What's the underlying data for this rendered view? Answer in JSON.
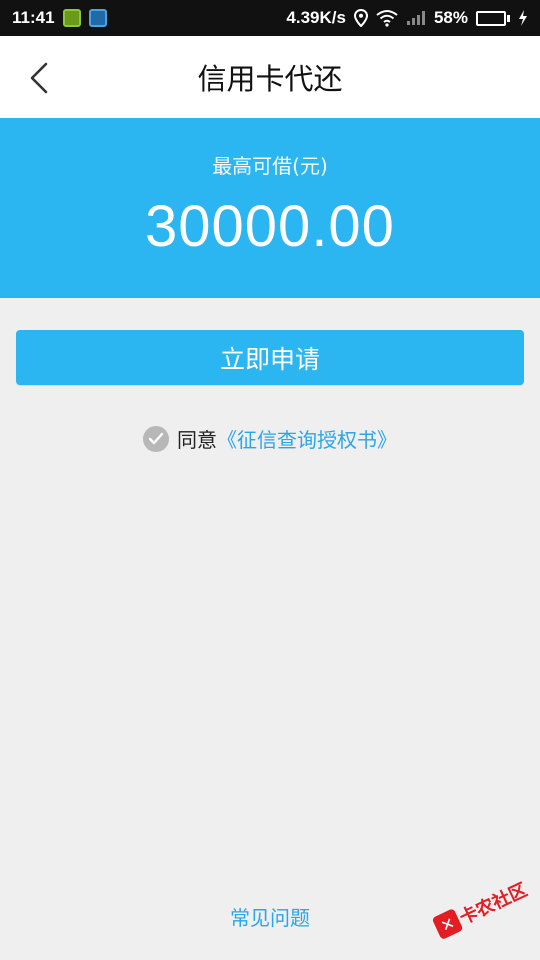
{
  "status_bar": {
    "time": "11:41",
    "net_speed": "4.39K/s",
    "battery_percent": "58%",
    "battery_level": 0.58
  },
  "nav": {
    "title": "信用卡代还"
  },
  "hero": {
    "label": "最高可借(元)",
    "amount": "30000.00"
  },
  "apply_button": "立即申请",
  "agreement": {
    "prefix": "同意",
    "link": "《征信查询授权书》"
  },
  "faq_link": "常见问题",
  "watermark": {
    "text": "卡农社区"
  },
  "colors": {
    "accent": "#2bb5f1",
    "link": "#2aa6e6"
  }
}
